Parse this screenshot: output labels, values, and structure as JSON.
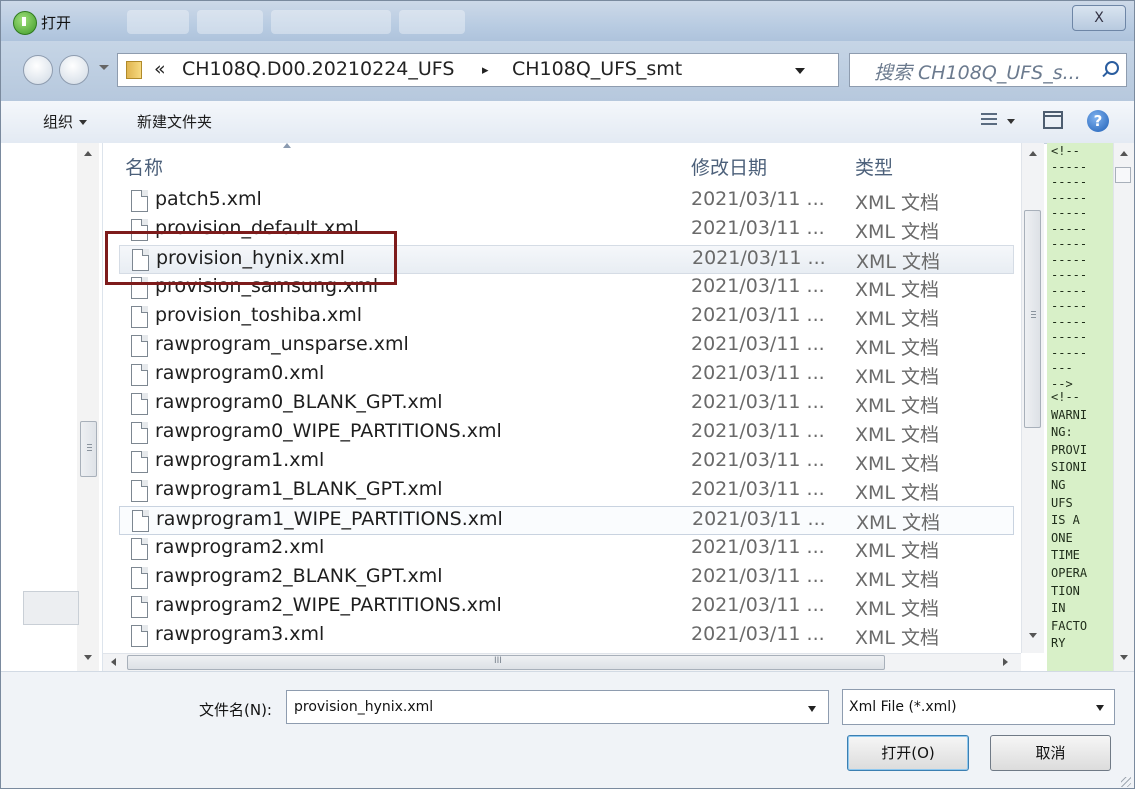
{
  "window": {
    "title": "打开",
    "close_label": "X"
  },
  "address": {
    "overflow_marker": "«",
    "crumbs": [
      "CH108Q.D00.20210224_UFS",
      "CH108Q_UFS_smt"
    ],
    "separator": "▸",
    "refresh_glyph": "↻"
  },
  "search": {
    "placeholder": "搜索 CH108Q_UFS_s..."
  },
  "toolbar": {
    "organize": "组织",
    "new_folder": "新建文件夹",
    "help": "?"
  },
  "list": {
    "columns": {
      "name": "名称",
      "date": "修改日期",
      "type": "类型"
    },
    "files": [
      {
        "name": "patch5.xml",
        "date": "2021/03/11 ...",
        "type": "XML 文档"
      },
      {
        "name": "provision_default.xml",
        "date": "2021/03/11 ...",
        "type": "XML 文档"
      },
      {
        "name": "provision_hynix.xml",
        "date": "2021/03/11 ...",
        "type": "XML 文档"
      },
      {
        "name": "provision_samsung.xml",
        "date": "2021/03/11 ...",
        "type": "XML 文档"
      },
      {
        "name": "provision_toshiba.xml",
        "date": "2021/03/11 ...",
        "type": "XML 文档"
      },
      {
        "name": "rawprogram_unsparse.xml",
        "date": "2021/03/11 ...",
        "type": "XML 文档"
      },
      {
        "name": "rawprogram0.xml",
        "date": "2021/03/11 ...",
        "type": "XML 文档"
      },
      {
        "name": "rawprogram0_BLANK_GPT.xml",
        "date": "2021/03/11 ...",
        "type": "XML 文档"
      },
      {
        "name": "rawprogram0_WIPE_PARTITIONS.xml",
        "date": "2021/03/11 ...",
        "type": "XML 文档"
      },
      {
        "name": "rawprogram1.xml",
        "date": "2021/03/11 ...",
        "type": "XML 文档"
      },
      {
        "name": "rawprogram1_BLANK_GPT.xml",
        "date": "2021/03/11 ...",
        "type": "XML 文档"
      },
      {
        "name": "rawprogram1_WIPE_PARTITIONS.xml",
        "date": "2021/03/11 ...",
        "type": "XML 文档"
      },
      {
        "name": "rawprogram2.xml",
        "date": "2021/03/11 ...",
        "type": "XML 文档"
      },
      {
        "name": "rawprogram2_BLANK_GPT.xml",
        "date": "2021/03/11 ...",
        "type": "XML 文档"
      },
      {
        "name": "rawprogram2_WIPE_PARTITIONS.xml",
        "date": "2021/03/11 ...",
        "type": "XML 文档"
      },
      {
        "name": "rawprogram3.xml",
        "date": "2021/03/11 ...",
        "type": "XML 文档"
      }
    ],
    "selected_file": "provision_hynix.xml",
    "hscroll_grip": "III"
  },
  "preview": {
    "lines": [
      "<!--",
      "-----",
      "-----",
      "-----",
      "-----",
      "-----",
      "-----",
      "-----",
      "-----",
      "-----",
      "-----",
      "-----",
      "-----",
      "-----",
      "---",
      "-->",
      "<!--",
      "WARNI",
      "NG:",
      "PROVI",
      "SIONI",
      "NG",
      "UFS",
      "IS A",
      "ONE",
      "TIME",
      "OPERA",
      "TION",
      "IN",
      "FACTO",
      "RY"
    ]
  },
  "footer": {
    "filename_label": "文件名(N):",
    "filename_value": "provision_hynix.xml",
    "filetype_value": "Xml File (*.xml)",
    "open_button": "打开(O)",
    "cancel_button": "取消"
  },
  "colors": {
    "selection_outline": "#7d1b1b",
    "preview_bg": "#d8f0c8",
    "titlebar": "#b9cce2"
  }
}
